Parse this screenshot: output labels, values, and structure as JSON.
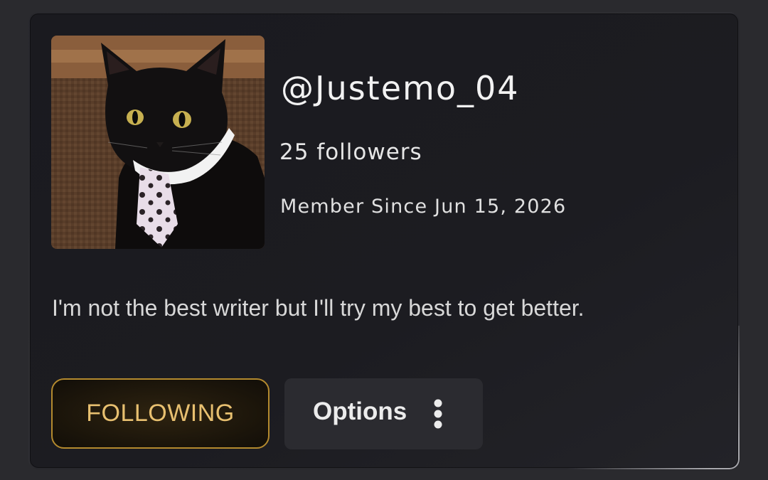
{
  "profile": {
    "username": "@Justemo_04",
    "followers": "25 followers",
    "member_since": "Member Since Jun 15, 2026",
    "bio": "I'm not the best writer but I'll try my best to get better.",
    "avatar_icon": "black-cat-in-tie-photo"
  },
  "actions": {
    "following_label": "FOLLOWING",
    "options_label": "Options",
    "options_icon": "vertical-dots-icon"
  },
  "colors": {
    "background": "#1a1a1f",
    "following_accent": "#e8c070",
    "following_border": "#b48a2e",
    "options_bg": "#2b2b30"
  }
}
